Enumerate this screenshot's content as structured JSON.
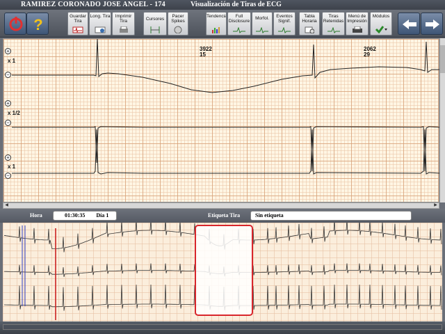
{
  "window": {
    "patient": "RAMIREZ CORONADO JOSE ANGEL - 174",
    "title": "Visualización de Tiras de ECG"
  },
  "toolbar": {
    "buttons": [
      {
        "label": "Guardar Tira",
        "icon": "save-strip-icon"
      },
      {
        "label": "Long. Tira",
        "icon": "strip-length-icon"
      },
      {
        "label": "Imprimir Tira",
        "icon": "print-icon"
      },
      {
        "label": "Cursores",
        "icon": "cursors-icon"
      },
      {
        "label": "Pacer Spikes",
        "icon": "pacer-icon"
      },
      {
        "label": "Tendencias",
        "icon": "trends-icon"
      },
      {
        "label": "Full Disclosure",
        "icon": "full-disclosure-icon"
      },
      {
        "label": "Morfol.",
        "icon": "morphology-icon"
      },
      {
        "label": "Eventos Signif.",
        "icon": "events-icon"
      },
      {
        "label": "Tabla Horaria",
        "icon": "hourly-table-icon"
      },
      {
        "label": "Tiras Retenidas",
        "icon": "retained-strips-icon"
      },
      {
        "label": "Menú de Impresión",
        "icon": "print-menu-icon"
      },
      {
        "label": "Módulos",
        "icon": "modules-icon"
      }
    ]
  },
  "strip": {
    "leads": [
      {
        "gain": "x 1"
      },
      {
        "gain": "x 1/2"
      },
      {
        "gain": "x 1"
      }
    ],
    "annotations": [
      {
        "value": "3922",
        "sub": "15"
      },
      {
        "value": "2062",
        "sub": "29"
      }
    ]
  },
  "info": {
    "hora_label": "Hora",
    "hora_value": "01:30:35",
    "dia_value": "Día 1",
    "etiqueta_label": "Etiqueta Tira",
    "etiqueta_value": "Sin etiqueta"
  },
  "colors": {
    "selection": "#d8252b",
    "trace": "#222222",
    "power_button": "#d82a2a",
    "help_button": "#f2c21a"
  }
}
